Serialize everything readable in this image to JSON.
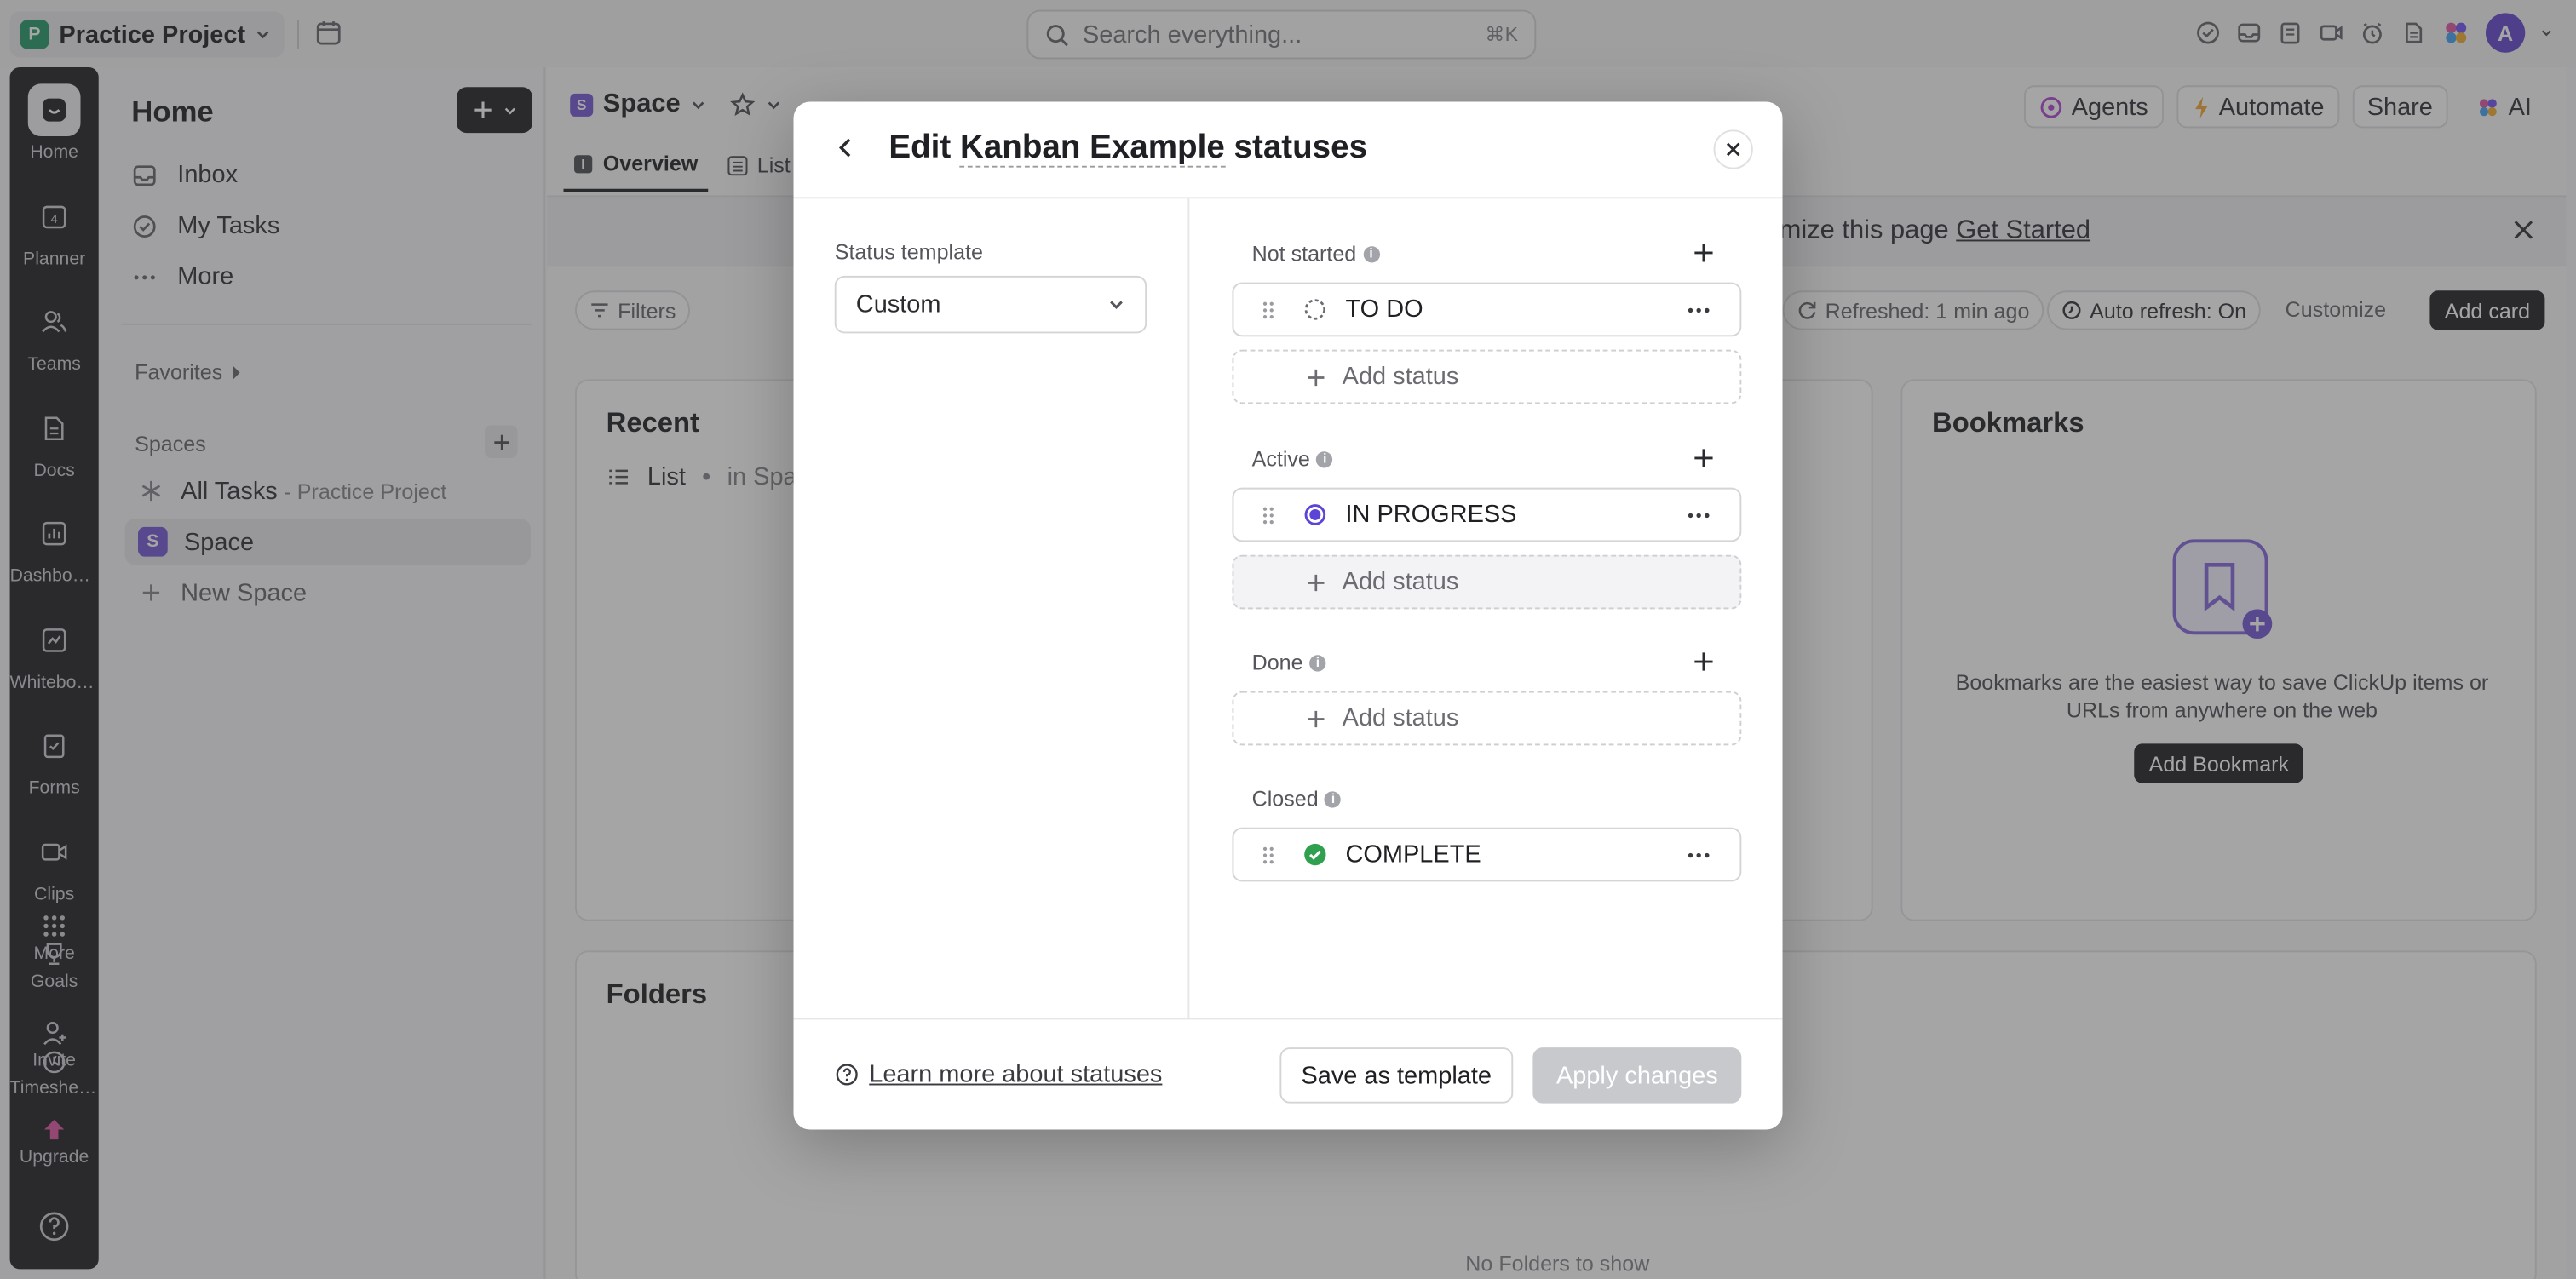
{
  "topbar": {
    "workspace_initial": "P",
    "workspace_name": "Practice Project",
    "search_placeholder": "Search everything...",
    "search_shortcut": "⌘K",
    "avatar_initial": "A"
  },
  "rail": {
    "items": [
      {
        "label": "Home",
        "icon": "home-icon"
      },
      {
        "label": "Planner",
        "icon": "calendar-icon"
      },
      {
        "label": "Teams",
        "icon": "teams-icon"
      },
      {
        "label": "Docs",
        "icon": "docs-icon"
      },
      {
        "label": "Dashboards",
        "icon": "dashboard-icon"
      },
      {
        "label": "Whiteboards",
        "icon": "whiteboard-icon"
      },
      {
        "label": "Forms",
        "icon": "forms-icon"
      },
      {
        "label": "Clips",
        "icon": "clips-icon"
      },
      {
        "label": "More",
        "icon": "grid-icon"
      },
      {
        "label": "Goals",
        "icon": "goals-icon"
      },
      {
        "label": "Invite",
        "icon": "invite-icon"
      },
      {
        "label": "Timesheets",
        "icon": "clock-icon"
      },
      {
        "label": "Upgrade",
        "icon": "upgrade-icon"
      }
    ],
    "planner_day": "4"
  },
  "sidebar": {
    "title": "Home",
    "nav": [
      {
        "label": "Inbox",
        "icon": "inbox-icon"
      },
      {
        "label": "My Tasks",
        "icon": "check-circle-icon"
      },
      {
        "label": "More",
        "icon": "ellipsis-icon"
      }
    ],
    "favorites_label": "Favorites",
    "spaces_label": "Spaces",
    "all_tasks_label": "All Tasks",
    "all_tasks_sub": "- Practice Project",
    "space_initial": "S",
    "space_name": "Space",
    "new_space_label": "New Space"
  },
  "main": {
    "breadcrumb": "Space",
    "tabs": [
      {
        "label": "Overview",
        "icon": "overview-icon"
      },
      {
        "label": "List",
        "icon": "list-icon"
      }
    ],
    "header_buttons": {
      "agents": "Agents",
      "automate": "Automate",
      "share": "Share",
      "ai": "AI"
    },
    "banner_text": "mize this page",
    "banner_link": "Get Started",
    "filters_label": "Filters",
    "refreshed_label": "Refreshed: 1 min ago",
    "auto_refresh_label": "Auto refresh: On",
    "customize_label": "Customize",
    "add_card_label": "Add card",
    "recent": {
      "title": "Recent",
      "item": "List",
      "item_sub": "in Spac"
    },
    "bookmarks": {
      "title": "Bookmarks",
      "text": "Bookmarks are the easiest way to save ClickUp items or URLs from anywhere on the web",
      "button": "Add Bookmark"
    },
    "folders": {
      "title": "Folders",
      "empty": "No Folders to show"
    }
  },
  "modal": {
    "title_prefix": "Edit",
    "title_name": "Kanban Example",
    "title_suffix": "statuses",
    "template_label": "Status template",
    "template_value": "Custom",
    "groups": {
      "not_started": {
        "label": "Not started",
        "statuses": [
          "TO DO"
        ],
        "add": "Add status"
      },
      "active": {
        "label": "Active",
        "statuses": [
          "IN PROGRESS"
        ],
        "add": "Add status"
      },
      "done": {
        "label": "Done",
        "add": "Add status"
      },
      "closed": {
        "label": "Closed",
        "statuses": [
          "COMPLETE"
        ]
      }
    },
    "learn_more": "Learn more about statuses",
    "save_template": "Save as template",
    "apply": "Apply changes"
  },
  "colors": {
    "in_progress": "#5b45d6",
    "complete": "#2fa04f",
    "workspace_badge": "#2f9e6e",
    "space_badge": "#7b5fd6"
  }
}
